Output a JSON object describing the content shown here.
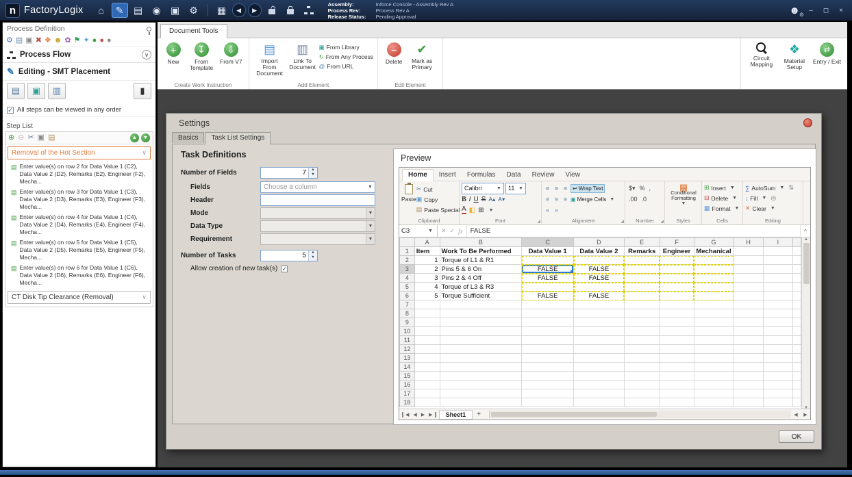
{
  "titlebar": {
    "logo_letter": "n",
    "app_name": "FactoryLogix",
    "nav_icons": [
      {
        "name": "home-icon",
        "glyph": "⌂"
      },
      {
        "name": "process-definition-icon",
        "glyph": "✎",
        "active": true
      },
      {
        "name": "work-instructions-icon",
        "glyph": "▤"
      },
      {
        "name": "production-icon",
        "glyph": "◉"
      },
      {
        "name": "copy-icon",
        "glyph": "▣"
      },
      {
        "name": "system-settings-icon",
        "glyph": "⚙"
      },
      {
        "name": "separator",
        "sep": true
      },
      {
        "name": "save-icon",
        "glyph": "▦"
      },
      {
        "name": "back-icon",
        "glyph": "◀",
        "circle": true
      },
      {
        "name": "forward-icon",
        "glyph": "▶",
        "circle": true
      },
      {
        "name": "unlock-icon",
        "lock": "open"
      },
      {
        "name": "lock-icon",
        "lock": "closed"
      },
      {
        "name": "process-tree-icon",
        "tree": true
      }
    ],
    "assembly_label": "Assembly:",
    "assembly_value": "Inforce Console - Assembly Rev A",
    "process_rev_label": "Process Rev:",
    "process_rev_value": "Process Rev A",
    "release_status_label": "Release Status:",
    "release_status_value": "Pending Approval",
    "window_controls": {
      "minimize": "–",
      "restore": "◻",
      "close": "×"
    }
  },
  "left_panel": {
    "title": "Process Definition",
    "toolbar_icons": [
      {
        "name": "settings-icon",
        "glyph": "⚙",
        "color": "#4f7fb5"
      },
      {
        "name": "print-icon",
        "glyph": "▤",
        "color": "#6a89a8"
      },
      {
        "name": "copy-icon",
        "glyph": "▣",
        "color": "#8a8a8a"
      },
      {
        "name": "delete-icon",
        "glyph": "✖",
        "color": "#c0504d"
      },
      {
        "name": "tree-view-icon",
        "glyph": "❖",
        "color": "#e07b39"
      },
      {
        "name": "person-icon",
        "glyph": "☻",
        "color": "#c9a227"
      },
      {
        "name": "palette-icon",
        "glyph": "✿",
        "color": "#9b59b6"
      },
      {
        "name": "flag-icon",
        "glyph": "⚑",
        "color": "#2e9e5b"
      },
      {
        "name": "tools-icon",
        "glyph": "✦",
        "color": "#5b9bd5"
      },
      {
        "name": "start-icon",
        "glyph": "●",
        "color": "#3f9e3f"
      },
      {
        "name": "stop-icon",
        "glyph": "●",
        "color": "#c0504d"
      },
      {
        "name": "help-icon",
        "glyph": "●",
        "color": "#8a8a8a"
      }
    ],
    "process_flow_label": "Process Flow",
    "editing_label": "Editing - SMT Placement",
    "order_checkbox_label": "All steps can be viewed in any order",
    "step_list_label": "Step List",
    "step_toolbar_icons": [
      {
        "name": "add-step-icon",
        "glyph": "⊕",
        "color": "#3f9e3f"
      },
      {
        "name": "delete-step-icon",
        "glyph": "⊖",
        "color": "#c9b8b8"
      },
      {
        "name": "cut-step-icon",
        "glyph": "✂",
        "color": "#5b7fa6"
      },
      {
        "name": "copy-step-icon",
        "glyph": "▣",
        "color": "#8a8a8a"
      },
      {
        "name": "paste-step-icon",
        "glyph": "▤",
        "color": "#b08d57"
      }
    ],
    "active_step_label": "Removal of the Hot Section",
    "steps": [
      "Enter value(s) on row 2 for Data Value 1 (C2), Data Value 2 (D2), Remarks (E2), Engineer (F2), Mecha...",
      "Enter value(s) on row 3 for Data Value 1 (C3), Data Value 2 (D3), Remarks (E3), Engineer (F3), Mecha...",
      "Enter value(s) on row 4 for Data Value 1 (C4), Data Value 2 (D4), Remarks (E4), Engineer (F4), Mecha...",
      "Enter value(s) on row 5 for Data Value 1 (C5), Data Value 2 (D5), Remarks (E5), Engineer (F5), Mecha...",
      "Enter value(s) on row 6 for Data Value 1 (C6), Data Value 2 (D6), Remarks (E6), Engineer (F6), Mecha..."
    ],
    "collapsed_step_label": "CT Disk Tip Clearance (Removal)"
  },
  "doc_ribbon": {
    "tab_label": "Document Tools",
    "new_label": "New",
    "from_template_label": "From Template",
    "from_v7_label": "From V7",
    "import_from_document_label": "Import From Document",
    "link_to_document_label": "Link To Document",
    "from_library_label": "From Library",
    "from_any_process_label": "From Any Process",
    "from_url_label": "From URL",
    "delete_label": "Delete",
    "mark_as_primary_label": "Mark as Primary",
    "group_create_label": "Create Work Instruction",
    "group_add_label": "Add Element",
    "group_edit_label": "Edit Element",
    "circuit_mapping_label": "Circuit Mapping",
    "material_setup_label": "Material Setup",
    "entry_exit_label": "Entry / Exit"
  },
  "settings_dialog": {
    "title": "Settings",
    "tabs": [
      "Basics",
      "Task List Settings"
    ],
    "section_title": "Task Definitions",
    "number_of_fields_label": "Number of Fields",
    "number_of_fields_value": "7",
    "fields_label": "Fields",
    "fields_value": "Choose a column",
    "header_label": "Header",
    "header_value": "",
    "mode_label": "Mode",
    "mode_value": "",
    "data_type_label": "Data Type",
    "data_type_value": "",
    "requirement_label": "Requirement",
    "requirement_value": "",
    "number_of_tasks_label": "Number of Tasks",
    "number_of_tasks_value": "5",
    "allow_new_tasks_label": "Allow creation of new task(s)",
    "ok_label": "OK",
    "preview": {
      "title": "Preview",
      "excel": {
        "tabs": [
          "Home",
          "Insert",
          "Formulas",
          "Data",
          "Review",
          "View"
        ],
        "active_tab": "Home",
        "paste_label": "Paste",
        "cut_label": "Cut",
        "copy_label": "Copy",
        "paste_special_label": "Paste Special",
        "clipboard_group_label": "Clipboard",
        "font_family": "Calibri",
        "font_size": "11",
        "font_group_label": "Font",
        "wrap_text_label": "Wrap Text",
        "merge_cells_label": "Merge Cells",
        "alignment_group_label": "Alignment",
        "number_group_label": "Number",
        "conditional_formatting_label": "Conditional Formatting",
        "styles_group_label": "Styles",
        "insert_label": "Insert",
        "delete_label": "Delete",
        "format_label": "Format",
        "cells_group_label": "Cells",
        "autosum_label": "AutoSum",
        "fill_label": "Fill",
        "clear_label": "Clear",
        "editing_group_label": "Editing",
        "name_box_value": "C3",
        "formula_value": "FALSE",
        "sheet_tab_label": "Sheet1",
        "add_sheet_label": "+"
      },
      "spreadsheet": {
        "columns": [
          {
            "letter": "A",
            "width": 37
          },
          {
            "letter": "B",
            "width": 120
          },
          {
            "letter": "C",
            "width": 76
          },
          {
            "letter": "D",
            "width": 74
          },
          {
            "letter": "E",
            "width": 52
          },
          {
            "letter": "F",
            "width": 50
          },
          {
            "letter": "G",
            "width": 58
          },
          {
            "letter": "H",
            "width": 44
          },
          {
            "letter": "I",
            "width": 44
          },
          {
            "letter": "",
            "width": 12
          }
        ],
        "header_row": [
          "Item",
          "Work To Be Performed",
          "Data Value 1",
          "Data Value 2",
          "Remarks",
          "Engineer",
          "Mechanical"
        ],
        "data_rows": [
          [
            "1",
            "Torque of L1 & R1",
            "",
            "",
            "",
            "",
            ""
          ],
          [
            "2",
            "Pins 5 & 6 On",
            "FALSE",
            "FALSE",
            "",
            "",
            ""
          ],
          [
            "3",
            "Pins 2 & 4 Off",
            "FALSE",
            "FALSE",
            "",
            "",
            ""
          ],
          [
            "4",
            "Torque of L3 & R3",
            "",
            "",
            "",
            "",
            ""
          ],
          [
            "5",
            "Torque Sufficient",
            "FALSE",
            "FALSE",
            "",
            "",
            ""
          ]
        ],
        "total_rows": 18,
        "selected_cell": "C3",
        "highlighted_columns": [
          "C",
          "D",
          "E",
          "F",
          "G"
        ],
        "highlighted_row_range": [
          2,
          6
        ]
      }
    }
  }
}
